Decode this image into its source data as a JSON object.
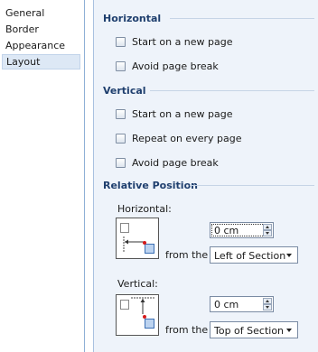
{
  "nav": {
    "items": [
      {
        "label": "General"
      },
      {
        "label": "Border"
      },
      {
        "label": "Appearance"
      },
      {
        "label": "Layout"
      }
    ],
    "selected": "Layout"
  },
  "horizontal": {
    "title": "Horizontal",
    "start_new_page": {
      "label": "Start on a new page",
      "checked": false
    },
    "avoid_page_break": {
      "label": "Avoid page break",
      "checked": false
    }
  },
  "vertical": {
    "title": "Vertical",
    "start_new_page": {
      "label": "Start on a new page",
      "checked": false
    },
    "repeat_every_page": {
      "label": "Repeat on every page",
      "checked": false
    },
    "avoid_page_break": {
      "label": "Avoid page break",
      "checked": false
    }
  },
  "relative_position": {
    "title": "Relative Position",
    "horizontal": {
      "label": "Horizontal:",
      "value": "0 cm",
      "from_label": "from the",
      "anchor": "Left of Section"
    },
    "vertical": {
      "label": "Vertical:",
      "value": "0 cm",
      "from_label": "from the",
      "anchor": "Top of Section"
    }
  },
  "colors": {
    "accent_title": "#1f3f6e",
    "panel_bg": "#eef3fa",
    "marker_red": "#d61a1a",
    "marker_blue": "#bcd3f0"
  }
}
